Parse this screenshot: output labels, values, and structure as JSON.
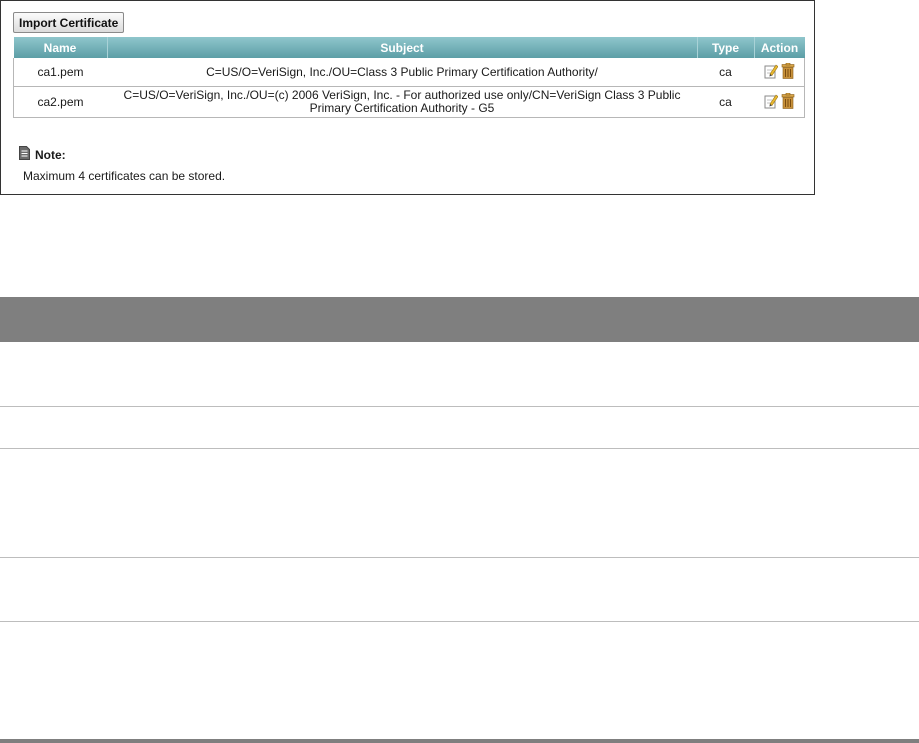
{
  "toolbar": {
    "import_label": "Import Certificate"
  },
  "table": {
    "headers": {
      "name": "Name",
      "subject": "Subject",
      "type": "Type",
      "action": "Action"
    },
    "rows": [
      {
        "name": "ca1.pem",
        "subject": "C=US/O=VeriSign, Inc./OU=Class 3 Public Primary Certification Authority/",
        "type": "ca"
      },
      {
        "name": "ca2.pem",
        "subject": "C=US/O=VeriSign, Inc./OU=(c) 2006 VeriSign, Inc. - For authorized use only/CN=VeriSign Class 3 Public Primary Certification Authority - G5",
        "type": "ca"
      }
    ]
  },
  "note": {
    "title": "Note:",
    "text": "Maximum 4 certificates can be stored."
  },
  "icons": {
    "edit": "edit-icon",
    "delete": "delete-icon",
    "note": "document-icon"
  },
  "colors": {
    "header_top": "#8fc6cc",
    "header_bottom": "#5c9ea6",
    "desc_header": "#7f7f7f",
    "trash": "#c8a24a"
  }
}
